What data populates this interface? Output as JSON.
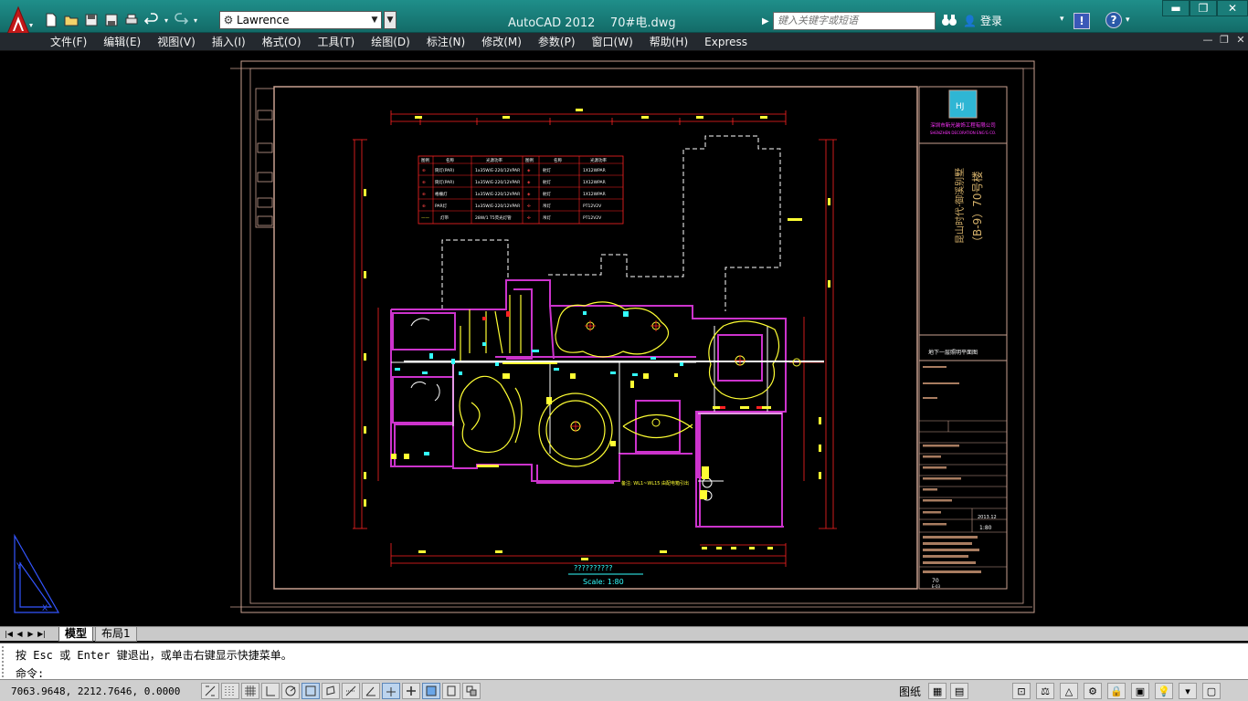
{
  "titlebar": {
    "workspace": "Lawrence",
    "app_name": "AutoCAD 2012",
    "file_name": "70#电.dwg",
    "search_placeholder": "键入关键字或短语",
    "login": "登录"
  },
  "menu": [
    "文件(F)",
    "编辑(E)",
    "视图(V)",
    "插入(I)",
    "格式(O)",
    "工具(T)",
    "绘图(D)",
    "标注(N)",
    "修改(M)",
    "参数(P)",
    "窗口(W)",
    "帮助(H)",
    "Express"
  ],
  "drawing": {
    "title_block": {
      "company_cn": "深圳市新光装饰工程有限公司",
      "company_en": "SHENZHEN DECORATION ENG'G CO.",
      "project": "昆山时代·御溪别墅",
      "building": "（B-9）70号楼",
      "sheet_title": "地下一层照明平面图",
      "date_value": "2013.12",
      "scale_value": "1:80",
      "sheet_no": "70",
      "sheet_sub": "E-03"
    },
    "plan_title": "??????????",
    "plan_scale": "Scale:  1:80",
    "note": "备注: WL1~WL15 由配电箱引出",
    "legend": {
      "headers": [
        "图例",
        "名称",
        "光源功率",
        "图例",
        "名称",
        "光源功率"
      ],
      "rows": [
        [
          "⊕",
          "筒灯(PAR)",
          "1x35W/E-220/12VPAR",
          "◈",
          "射灯",
          "1X12WPAR"
        ],
        [
          "⊕",
          "筒灯(PAR)",
          "1x35W/E-220/12VPAR",
          "◈",
          "射灯",
          "1X12WPAR"
        ],
        [
          "⊕",
          "格栅灯",
          "1x35W/E-220/12VPAR",
          "◈",
          "射灯",
          "1X12WPAR"
        ],
        [
          "⊕",
          "PAR灯",
          "1x35W/E-220/12VPAR",
          "✣",
          "吊灯",
          "PT12V2V"
        ],
        [
          "——",
          "灯带",
          "28W/1 T5荧光灯管",
          "✣",
          "吊灯",
          "PT12V2V"
        ]
      ]
    }
  },
  "tabs": {
    "model": "模型",
    "layout1": "布局1"
  },
  "command": {
    "history": "按 Esc 或 Enter 键退出，或单击右键显示快捷菜单。",
    "prompt": "命令:"
  },
  "status": {
    "coords": "7063.9648, 2212.7646, 0.0000",
    "paper": "图纸"
  },
  "colors": {
    "titlebar": "#1a7d79",
    "menubar": "#24292f",
    "canvas": "#000000",
    "wall": "#cc33cc",
    "dimension": "#ff2222",
    "lighting": "#ffff33",
    "annotation": "#33ffff",
    "frame": "#c8a090"
  }
}
